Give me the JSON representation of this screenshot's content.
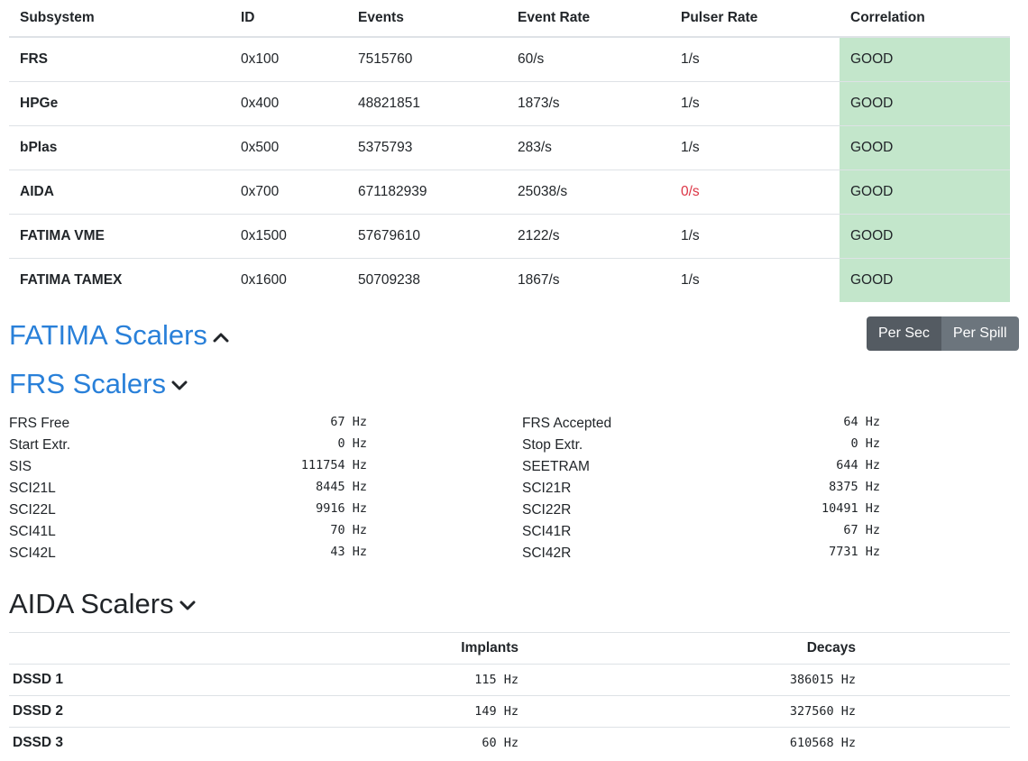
{
  "subsystems": {
    "headers": [
      "Subsystem",
      "ID",
      "Events",
      "Event Rate",
      "Pulser Rate",
      "Correlation"
    ],
    "rows": [
      {
        "name": "FRS",
        "id": "0x100",
        "events": "7515760",
        "event_rate": "60/s",
        "pulser_rate": "1/s",
        "correlation": "GOOD"
      },
      {
        "name": "HPGe",
        "id": "0x400",
        "events": "48821851",
        "event_rate": "1873/s",
        "pulser_rate": "1/s",
        "correlation": "GOOD"
      },
      {
        "name": "bPlas",
        "id": "0x500",
        "events": "5375793",
        "event_rate": "283/s",
        "pulser_rate": "1/s",
        "correlation": "GOOD"
      },
      {
        "name": "AIDA",
        "id": "0x700",
        "events": "671182939",
        "event_rate": "25038/s",
        "pulser_rate": "0/s",
        "correlation": "GOOD"
      },
      {
        "name": "FATIMA VME",
        "id": "0x1500",
        "events": "57679610",
        "event_rate": "2122/s",
        "pulser_rate": "1/s",
        "correlation": "GOOD"
      },
      {
        "name": "FATIMA TAMEX",
        "id": "0x1600",
        "events": "50709238",
        "event_rate": "1867/s",
        "pulser_rate": "1/s",
        "correlation": "GOOD"
      }
    ]
  },
  "colors": {
    "good_bg": "#c3e6cb",
    "bad_text": "#dc3545",
    "link_blue": "#2980d9"
  },
  "fatima": {
    "title": "FATIMA Scalers",
    "chevron": "chevron-up-icon"
  },
  "toggle": {
    "per_sec": "Per Sec",
    "per_spill": "Per Spill"
  },
  "frs": {
    "title": "FRS Scalers",
    "chevron": "chevron-down-icon",
    "left": [
      {
        "label": "FRS Free",
        "value": "67 Hz"
      },
      {
        "label": "Start Extr.",
        "value": "0 Hz"
      },
      {
        "label": "SIS",
        "value": "111754 Hz"
      },
      {
        "label": "SCI21L",
        "value": "8445 Hz"
      },
      {
        "label": "SCI22L",
        "value": "9916 Hz"
      },
      {
        "label": "SCI41L",
        "value": "70 Hz"
      },
      {
        "label": "SCI42L",
        "value": "43 Hz"
      }
    ],
    "right": [
      {
        "label": "FRS Accepted",
        "value": "64 Hz"
      },
      {
        "label": "Stop Extr.",
        "value": "0 Hz"
      },
      {
        "label": "SEETRAM",
        "value": "644 Hz"
      },
      {
        "label": "SCI21R",
        "value": "8375 Hz"
      },
      {
        "label": "SCI22R",
        "value": "10491 Hz"
      },
      {
        "label": "SCI41R",
        "value": "67 Hz"
      },
      {
        "label": "SCI42R",
        "value": "7731 Hz"
      }
    ]
  },
  "aida": {
    "title": "AIDA Scalers",
    "chevron": "chevron-down-icon",
    "headers": [
      "",
      "Implants",
      "Decays"
    ],
    "rows": [
      {
        "name": "DSSD 1",
        "implants": "115 Hz",
        "decays": "386015 Hz"
      },
      {
        "name": "DSSD 2",
        "implants": "149 Hz",
        "decays": "327560 Hz"
      },
      {
        "name": "DSSD 3",
        "implants": "60 Hz",
        "decays": "610568 Hz"
      }
    ]
  }
}
